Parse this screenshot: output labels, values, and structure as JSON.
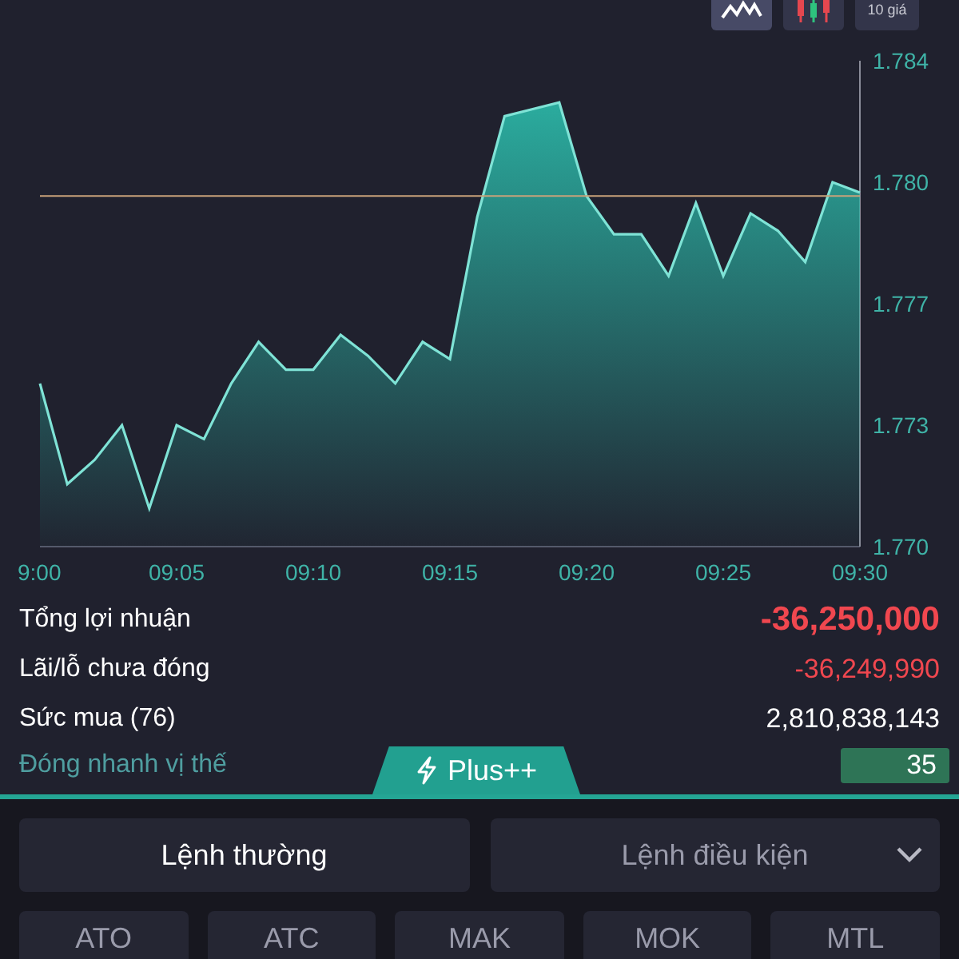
{
  "chart_toolbar": [
    {
      "kind": "line",
      "selected": true
    },
    {
      "kind": "candles",
      "selected": false
    },
    {
      "kind": "levels",
      "label": "10 giá",
      "selected": false
    }
  ],
  "chart_data": {
    "type": "area",
    "x": [
      "9:00",
      null,
      null,
      null,
      null,
      "09:05",
      null,
      null,
      null,
      null,
      "09:10",
      null,
      null,
      null,
      null,
      "09:15",
      null,
      null,
      null,
      null,
      "09:20",
      null,
      null,
      null,
      null,
      "09:25",
      null,
      null,
      null,
      null,
      "09:30"
    ],
    "series": [
      {
        "color": "#7fe3d6",
        "values": [
          1.7747,
          1.7718,
          1.7725,
          1.7735,
          1.7711,
          1.7735,
          1.7731,
          1.7747,
          1.7759,
          1.7751,
          1.7751,
          1.7761,
          1.7755,
          1.7747,
          1.7759,
          1.7754,
          1.7795,
          1.7824,
          1.7826,
          1.7828,
          1.7801,
          1.779,
          1.779,
          1.7778,
          1.7799,
          1.7778,
          1.7796,
          1.7791,
          1.7782,
          1.7805,
          1.7802
        ]
      }
    ],
    "ylim": [
      1.77,
      1.784
    ],
    "yticks": [
      {
        "value": 1.77,
        "label": "1.770"
      },
      {
        "value": 1.7735,
        "label": "1.773"
      },
      {
        "value": 1.777,
        "label": "1.777"
      },
      {
        "value": 1.7805,
        "label": "1.780"
      },
      {
        "value": 1.784,
        "label": "1.784"
      }
    ],
    "ref_lines": [
      {
        "axis": "y",
        "value": 1.7801
      }
    ]
  },
  "summary": [
    {
      "label": "Tổng lợi nhuận",
      "value": "-36,250,000",
      "negative": true,
      "emphasis": true
    },
    {
      "label": "Lãi/lỗ chưa đóng",
      "value": "-36,249,990",
      "negative": true,
      "emphasis": false
    },
    {
      "label": "Sức mua (76)",
      "value": "2,810,838,143",
      "negative": false,
      "emphasis": false
    }
  ],
  "quick_close": {
    "label": "Đóng nhanh vị thế",
    "value": "35"
  },
  "plus_tab": {
    "label": "Plus++"
  },
  "order_modes": [
    {
      "label": "Lệnh thường",
      "selected": true,
      "dropdown": false
    },
    {
      "label": "Lệnh điều kiện",
      "selected": false,
      "dropdown": true
    }
  ],
  "order_types": [
    "ATO",
    "ATC",
    "MAK",
    "MOK",
    "MTL"
  ]
}
